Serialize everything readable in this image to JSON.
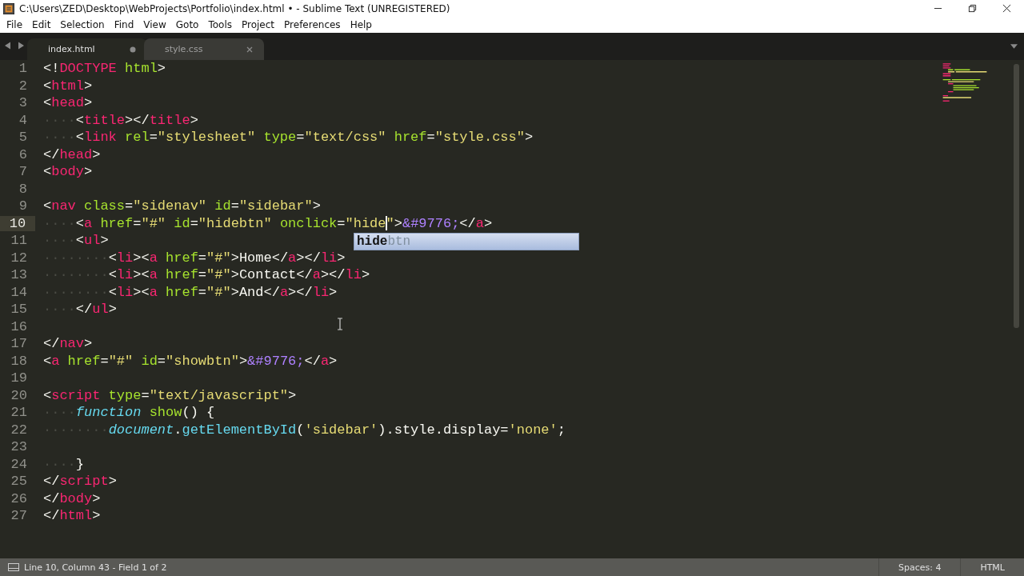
{
  "window": {
    "title": "C:\\Users\\ZED\\Desktop\\WebProjects\\Portfolio\\index.html • - Sublime Text (UNREGISTERED)"
  },
  "menu": [
    "File",
    "Edit",
    "Selection",
    "Find",
    "View",
    "Goto",
    "Tools",
    "Project",
    "Preferences",
    "Help"
  ],
  "tabs": [
    {
      "label": "index.html",
      "selected": true,
      "modified": true
    },
    {
      "label": "style.css",
      "selected": false,
      "modified": false
    }
  ],
  "editor": {
    "lines": [
      {
        "number": "1",
        "current": false,
        "tokens": [
          {
            "kind": "punct",
            "text": "<!"
          },
          {
            "kind": "tag",
            "text": "DOCTYPE"
          },
          {
            "kind": "attr",
            "text": " html"
          },
          {
            "kind": "punct",
            "text": ">"
          }
        ]
      },
      {
        "number": "2",
        "current": false,
        "tokens": [
          {
            "kind": "punct",
            "text": "<"
          },
          {
            "kind": "tag",
            "text": "html"
          },
          {
            "kind": "punct",
            "text": ">"
          }
        ]
      },
      {
        "number": "3",
        "current": false,
        "tokens": [
          {
            "kind": "punct",
            "text": "<"
          },
          {
            "kind": "tag",
            "text": "head"
          },
          {
            "kind": "punct",
            "text": ">"
          }
        ]
      },
      {
        "number": "4",
        "current": false,
        "tokens": [
          {
            "kind": "ws",
            "text": "····"
          },
          {
            "kind": "punct",
            "text": "<"
          },
          {
            "kind": "tag",
            "text": "title"
          },
          {
            "kind": "punct",
            "text": "></"
          },
          {
            "kind": "tag",
            "text": "title"
          },
          {
            "kind": "punct",
            "text": ">"
          }
        ]
      },
      {
        "number": "5",
        "current": false,
        "tokens": [
          {
            "kind": "ws",
            "text": "····"
          },
          {
            "kind": "punct",
            "text": "<"
          },
          {
            "kind": "tag",
            "text": "link"
          },
          {
            "kind": "attr",
            "text": " rel"
          },
          {
            "kind": "punct",
            "text": "="
          },
          {
            "kind": "string",
            "text": "\"stylesheet\""
          },
          {
            "kind": "attr",
            "text": " type"
          },
          {
            "kind": "punct",
            "text": "="
          },
          {
            "kind": "string",
            "text": "\"text/css\""
          },
          {
            "kind": "attr",
            "text": " href"
          },
          {
            "kind": "punct",
            "text": "="
          },
          {
            "kind": "string",
            "text": "\"style.css\""
          },
          {
            "kind": "punct",
            "text": ">"
          }
        ]
      },
      {
        "number": "6",
        "current": false,
        "tokens": [
          {
            "kind": "punct",
            "text": "</"
          },
          {
            "kind": "tag",
            "text": "head"
          },
          {
            "kind": "punct",
            "text": ">"
          }
        ]
      },
      {
        "number": "7",
        "current": false,
        "tokens": [
          {
            "kind": "punct",
            "text": "<"
          },
          {
            "kind": "tag",
            "text": "body"
          },
          {
            "kind": "punct",
            "text": ">"
          }
        ]
      },
      {
        "number": "8",
        "current": false
      },
      {
        "number": "9",
        "current": false,
        "tokens": [
          {
            "kind": "punct",
            "text": "<"
          },
          {
            "kind": "tag",
            "text": "nav"
          },
          {
            "kind": "attr",
            "text": " class"
          },
          {
            "kind": "punct",
            "text": "="
          },
          {
            "kind": "string",
            "text": "\"sidenav\""
          },
          {
            "kind": "attr",
            "text": " id"
          },
          {
            "kind": "punct",
            "text": "="
          },
          {
            "kind": "string",
            "text": "\"sidebar\""
          },
          {
            "kind": "punct",
            "text": ">"
          }
        ]
      },
      {
        "number": "10",
        "current": true,
        "tokens": [
          {
            "kind": "ws",
            "text": "····"
          },
          {
            "kind": "punct",
            "text": "<"
          },
          {
            "kind": "tag",
            "text": "a"
          },
          {
            "kind": "attr",
            "text": " href"
          },
          {
            "kind": "punct",
            "text": "="
          },
          {
            "kind": "string",
            "text": "\"#\""
          },
          {
            "kind": "attr",
            "text": " id"
          },
          {
            "kind": "punct",
            "text": "="
          },
          {
            "kind": "string",
            "text": "\"hidebtn\""
          },
          {
            "kind": "attr",
            "text": " onclick"
          },
          {
            "kind": "punct",
            "text": "="
          },
          {
            "kind": "string",
            "text": "\"hide"
          },
          {
            "kind": "caret"
          },
          {
            "kind": "string",
            "text": "\""
          },
          {
            "kind": "punct",
            "text": ">"
          },
          {
            "kind": "entity",
            "text": "&#9776;"
          },
          {
            "kind": "punct",
            "text": "</"
          },
          {
            "kind": "tag",
            "text": "a"
          },
          {
            "kind": "punct",
            "text": ">"
          }
        ]
      },
      {
        "number": "11",
        "current": false,
        "tokens": [
          {
            "kind": "ws",
            "text": "····"
          },
          {
            "kind": "punct",
            "text": "<"
          },
          {
            "kind": "tag",
            "text": "ul"
          },
          {
            "kind": "punct",
            "text": ">"
          }
        ]
      },
      {
        "number": "12",
        "current": false,
        "tokens": [
          {
            "kind": "ws",
            "text": "········"
          },
          {
            "kind": "punct",
            "text": "<"
          },
          {
            "kind": "tag",
            "text": "li"
          },
          {
            "kind": "punct",
            "text": "><"
          },
          {
            "kind": "tag",
            "text": "a"
          },
          {
            "kind": "attr",
            "text": " href"
          },
          {
            "kind": "punct",
            "text": "="
          },
          {
            "kind": "string",
            "text": "\"#\""
          },
          {
            "kind": "punct",
            "text": ">"
          },
          {
            "kind": "text",
            "text": "Home"
          },
          {
            "kind": "punct",
            "text": "</"
          },
          {
            "kind": "tag",
            "text": "a"
          },
          {
            "kind": "punct",
            "text": "></"
          },
          {
            "kind": "tag",
            "text": "li"
          },
          {
            "kind": "punct",
            "text": ">"
          }
        ]
      },
      {
        "number": "13",
        "current": false,
        "tokens": [
          {
            "kind": "ws",
            "text": "········"
          },
          {
            "kind": "punct",
            "text": "<"
          },
          {
            "kind": "tag",
            "text": "li"
          },
          {
            "kind": "punct",
            "text": "><"
          },
          {
            "kind": "tag",
            "text": "a"
          },
          {
            "kind": "attr",
            "text": " href"
          },
          {
            "kind": "punct",
            "text": "="
          },
          {
            "kind": "string",
            "text": "\"#\""
          },
          {
            "kind": "punct",
            "text": ">"
          },
          {
            "kind": "text",
            "text": "Contact"
          },
          {
            "kind": "punct",
            "text": "</"
          },
          {
            "kind": "tag",
            "text": "a"
          },
          {
            "kind": "punct",
            "text": "></"
          },
          {
            "kind": "tag",
            "text": "li"
          },
          {
            "kind": "punct",
            "text": ">"
          }
        ]
      },
      {
        "number": "14",
        "current": false,
        "tokens": [
          {
            "kind": "ws",
            "text": "········"
          },
          {
            "kind": "punct",
            "text": "<"
          },
          {
            "kind": "tag",
            "text": "li"
          },
          {
            "kind": "punct",
            "text": "><"
          },
          {
            "kind": "tag",
            "text": "a"
          },
          {
            "kind": "attr",
            "text": " href"
          },
          {
            "kind": "punct",
            "text": "="
          },
          {
            "kind": "string",
            "text": "\"#\""
          },
          {
            "kind": "punct",
            "text": ">"
          },
          {
            "kind": "text",
            "text": "And"
          },
          {
            "kind": "punct",
            "text": "</"
          },
          {
            "kind": "tag",
            "text": "a"
          },
          {
            "kind": "punct",
            "text": "></"
          },
          {
            "kind": "tag",
            "text": "li"
          },
          {
            "kind": "punct",
            "text": ">"
          }
        ]
      },
      {
        "number": "15",
        "current": false,
        "tokens": [
          {
            "kind": "ws",
            "text": "····"
          },
          {
            "kind": "punct",
            "text": "</"
          },
          {
            "kind": "tag",
            "text": "ul"
          },
          {
            "kind": "punct",
            "text": ">"
          }
        ]
      },
      {
        "number": "16",
        "current": false
      },
      {
        "number": "17",
        "current": false,
        "tokens": [
          {
            "kind": "punct",
            "text": "</"
          },
          {
            "kind": "tag",
            "text": "nav"
          },
          {
            "kind": "punct",
            "text": ">"
          }
        ]
      },
      {
        "number": "18",
        "current": false,
        "tokens": [
          {
            "kind": "punct",
            "text": "<"
          },
          {
            "kind": "tag",
            "text": "a"
          },
          {
            "kind": "attr",
            "text": " href"
          },
          {
            "kind": "punct",
            "text": "="
          },
          {
            "kind": "string",
            "text": "\"#\""
          },
          {
            "kind": "attr",
            "text": " id"
          },
          {
            "kind": "punct",
            "text": "="
          },
          {
            "kind": "string",
            "text": "\"showbtn\""
          },
          {
            "kind": "punct",
            "text": ">"
          },
          {
            "kind": "entity",
            "text": "&#9776;"
          },
          {
            "kind": "punct",
            "text": "</"
          },
          {
            "kind": "tag",
            "text": "a"
          },
          {
            "kind": "punct",
            "text": ">"
          }
        ]
      },
      {
        "number": "19",
        "current": false
      },
      {
        "number": "20",
        "current": false,
        "tokens": [
          {
            "kind": "punct",
            "text": "<"
          },
          {
            "kind": "tag",
            "text": "script"
          },
          {
            "kind": "attr",
            "text": " type"
          },
          {
            "kind": "punct",
            "text": "="
          },
          {
            "kind": "string",
            "text": "\"text/javascript\""
          },
          {
            "kind": "punct",
            "text": ">"
          }
        ]
      },
      {
        "number": "21",
        "current": false,
        "tokens": [
          {
            "kind": "ws",
            "text": "····"
          },
          {
            "kind": "keyword",
            "text": "function"
          },
          {
            "kind": "func",
            "text": " show"
          },
          {
            "kind": "punct",
            "text": "() {"
          }
        ]
      },
      {
        "number": "22",
        "current": false,
        "tokens": [
          {
            "kind": "ws",
            "text": "········"
          },
          {
            "kind": "keyword",
            "text": "document"
          },
          {
            "kind": "punct",
            "text": "."
          },
          {
            "kind": "method",
            "text": "getElementById"
          },
          {
            "kind": "punct",
            "text": "("
          },
          {
            "kind": "string",
            "text": "'sidebar'"
          },
          {
            "kind": "punct",
            "text": ").style.display="
          },
          {
            "kind": "string",
            "text": "'none'"
          },
          {
            "kind": "punct",
            "text": ";"
          }
        ]
      },
      {
        "number": "23",
        "current": false
      },
      {
        "number": "24",
        "current": false,
        "tokens": [
          {
            "kind": "ws",
            "text": "····"
          },
          {
            "kind": "punct",
            "text": "}"
          }
        ]
      },
      {
        "number": "25",
        "current": false,
        "tokens": [
          {
            "kind": "punct",
            "text": "</"
          },
          {
            "kind": "tag",
            "text": "script"
          },
          {
            "kind": "punct",
            "text": ">"
          }
        ]
      },
      {
        "number": "26",
        "current": false,
        "tokens": [
          {
            "kind": "punct",
            "text": "</"
          },
          {
            "kind": "tag",
            "text": "body"
          },
          {
            "kind": "punct",
            "text": ">"
          }
        ]
      },
      {
        "number": "27",
        "current": false,
        "tokens": [
          {
            "kind": "punct",
            "text": "</"
          },
          {
            "kind": "tag",
            "text": "html"
          },
          {
            "kind": "punct",
            "text": ">"
          }
        ]
      }
    ],
    "autocomplete": {
      "items": [
        {
          "text": "**hide**btn",
          "selected": true
        }
      ]
    }
  },
  "status_bar": {
    "position": "Line 10, Column 43 - Field 1 of 2",
    "indentation": "Spaces: 4",
    "syntax": "HTML"
  }
}
